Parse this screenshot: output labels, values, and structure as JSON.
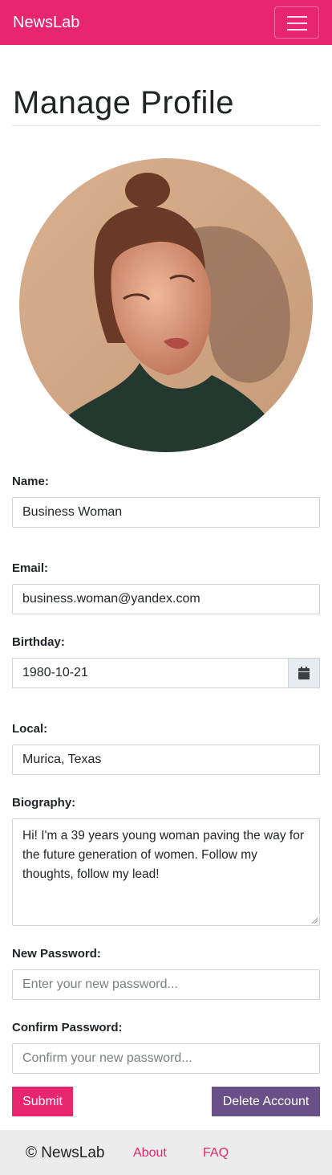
{
  "navbar": {
    "brand": "NewsLab",
    "menu_icon": "hamburger-icon",
    "color": "#e8266f"
  },
  "page": {
    "title": "Manage Profile"
  },
  "profile": {
    "avatar_alt": "profile-photo"
  },
  "form": {
    "name": {
      "label": "Name:",
      "value": "Business Woman"
    },
    "email": {
      "label": "Email:",
      "value": "business.woman@yandex.com"
    },
    "birthday": {
      "label": "Birthday:",
      "value": "1980-10-21",
      "icon": "calendar-icon"
    },
    "local": {
      "label": "Local:",
      "value": "Murica, Texas"
    },
    "biography": {
      "label": "Biography:",
      "value": "Hi! I'm a 39 years young woman paving the way for the future generation of women. Follow my thoughts, follow my lead!"
    },
    "new_password": {
      "label": "New Password:",
      "placeholder": "Enter your new password..."
    },
    "confirm_password": {
      "label": "Confirm Password:",
      "placeholder": "Confirm your new password..."
    },
    "submit_label": "Submit",
    "delete_label": "Delete Account"
  },
  "footer": {
    "copyright": "© NewsLab",
    "links": [
      "About",
      "FAQ"
    ]
  },
  "colors": {
    "accent": "#e8266f",
    "danger_alt": "#6a5088"
  }
}
